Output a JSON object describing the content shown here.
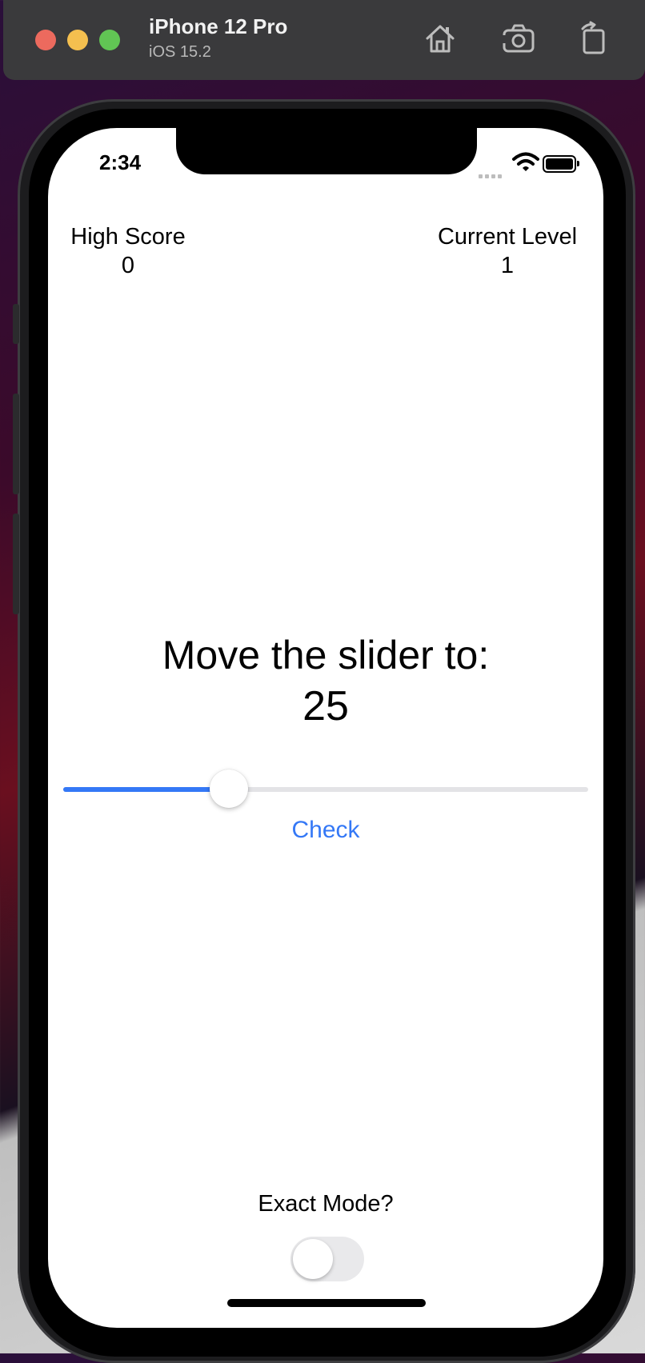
{
  "window": {
    "device_name": "iPhone 12 Pro",
    "os_version": "iOS 15.2",
    "toolbar_icons": [
      "home-icon",
      "screenshot-camera-icon",
      "rotate-icon"
    ]
  },
  "status_bar": {
    "time": "2:34",
    "icons": [
      "cellular-signal-icon",
      "wifi-icon",
      "battery-icon"
    ]
  },
  "stats": {
    "high_score_label": "High Score",
    "high_score_value": "0",
    "current_level_label": "Current Level",
    "current_level_value": "1"
  },
  "game": {
    "prompt": "Move the slider to:",
    "target": "25",
    "slider_value_fraction": 0.315,
    "check_label": "Check"
  },
  "exact_mode": {
    "label": "Exact Mode?",
    "enabled": false
  },
  "colors": {
    "accent": "#3478f6",
    "track": "#e3e3e6",
    "toggle_off": "#e9e9eb"
  }
}
